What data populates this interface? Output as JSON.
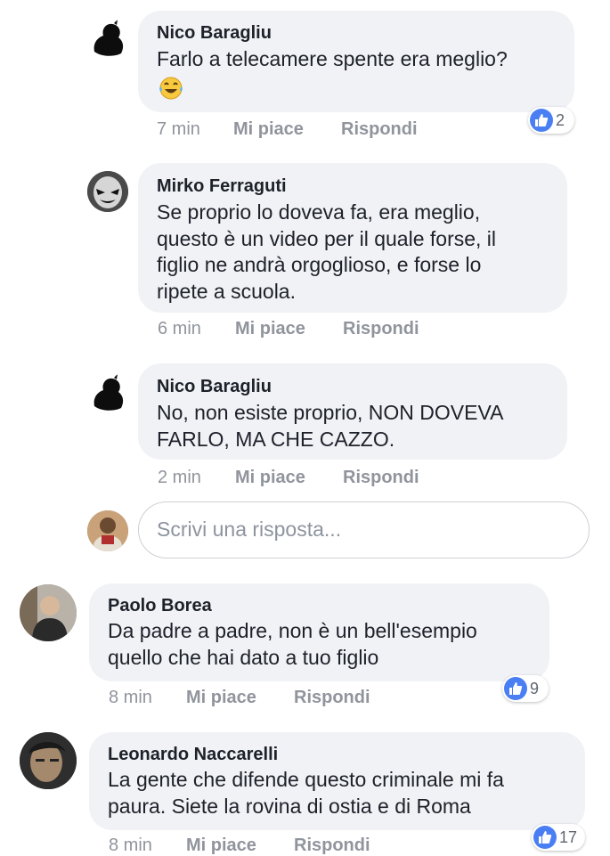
{
  "colors": {
    "bubble": "#f1f2f6",
    "like": "#4a7ff4",
    "meta": "#90949c",
    "text": "#1d2129"
  },
  "icons": {
    "like": "like-thumb-icon",
    "laugh": "laughing-emoji-icon"
  },
  "comments": [
    {
      "author": "Nico Baragliu",
      "text": "Farlo a telecamere spente era meglio?",
      "emoji": "😂",
      "time": "7 min",
      "like_label": "Mi piace",
      "reply_label": "Rispondi",
      "reactions": "2"
    },
    {
      "author": "Mirko Ferraguti",
      "text": "Se proprio lo doveva fa, era meglio,\nquesto è un video per il quale forse, il\nfiglio ne andrà orgoglioso, e forse lo\nripete a scuola.",
      "time": "6 min",
      "like_label": "Mi piace",
      "reply_label": "Rispondi"
    },
    {
      "author": "Nico Baragliu",
      "text": "No, non esiste proprio, NON DOVEVA\nFARLO, MA CHE CAZZO.",
      "time": "2 min",
      "like_label": "Mi piace",
      "reply_label": "Rispondi"
    },
    {
      "author": "Paolo Borea",
      "text": "Da padre a padre, non è un bell'esempio\nquello che hai dato a tuo figlio",
      "time": "8 min",
      "like_label": "Mi piace",
      "reply_label": "Rispondi",
      "reactions": "9"
    },
    {
      "author": "Leonardo Naccarelli",
      "text": "La gente che difende questo criminale mi fa\npaura. Siete la rovina di ostia e di Roma",
      "time": "8 min",
      "like_label": "Mi piace",
      "reply_label": "Rispondi",
      "reactions": "17"
    }
  ],
  "reply_box": {
    "placeholder": "Scrivi una risposta..."
  }
}
